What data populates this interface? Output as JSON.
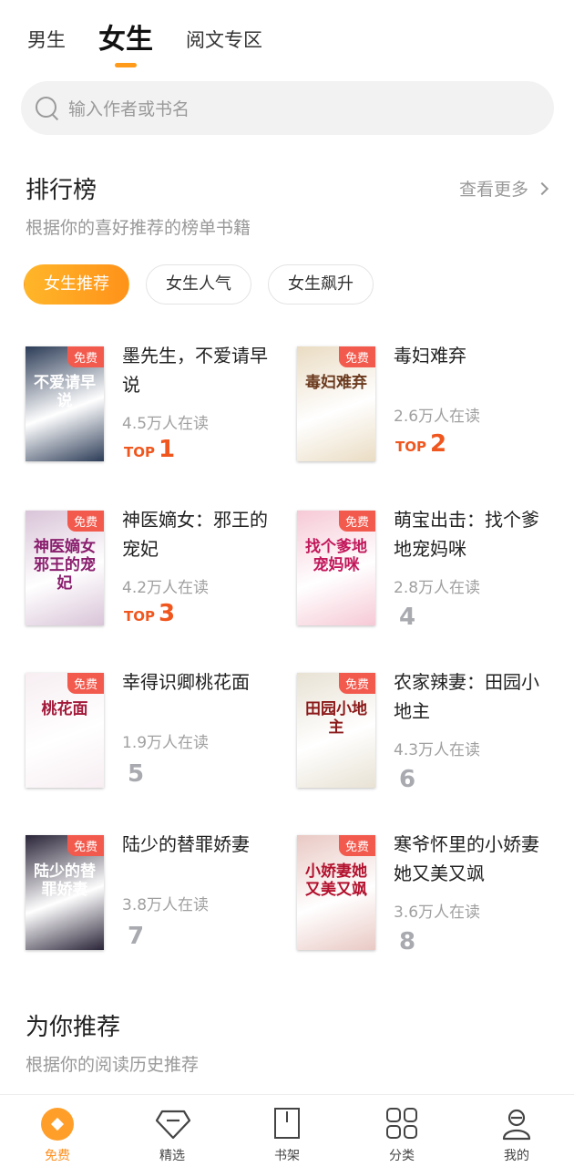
{
  "top_tabs": [
    {
      "label": "男生",
      "active": false
    },
    {
      "label": "女生",
      "active": true
    },
    {
      "label": "阅文专区",
      "active": false
    }
  ],
  "search": {
    "placeholder": "输入作者或书名"
  },
  "ranking": {
    "title": "排行榜",
    "subtitle": "根据你的喜好推荐的榜单书籍",
    "more_label": "查看更多",
    "chips": [
      {
        "label": "女生推荐",
        "active": true
      },
      {
        "label": "女生人气",
        "active": false
      },
      {
        "label": "女生飙升",
        "active": false
      }
    ],
    "books": [
      {
        "title": "墨先生，不爱请早说",
        "readers": "4.5万人在读",
        "rank": "1",
        "top": true,
        "badge": "免费",
        "cover_text": "不爱请早说",
        "cover_bg": "#2c3c57",
        "cover_fg": "#ffffff"
      },
      {
        "title": "毒妇难弃",
        "readers": "2.6万人在读",
        "rank": "2",
        "top": true,
        "badge": "免费",
        "cover_text": "毒妇难弃",
        "cover_bg": "#eadcc3",
        "cover_fg": "#6b3a1e"
      },
      {
        "title": "神医嫡女：邪王的宠妃",
        "readers": "4.2万人在读",
        "rank": "3",
        "top": true,
        "badge": "免费",
        "cover_text": "神医嫡女 邪王的宠妃",
        "cover_bg": "#d9c4d8",
        "cover_fg": "#8a1f6e"
      },
      {
        "title": "萌宝出击：找个爹地宠妈咪",
        "readers": "2.8万人在读",
        "rank": "4",
        "top": false,
        "badge": "免费",
        "cover_text": "找个爹地宠妈咪",
        "cover_bg": "#f6c9d6",
        "cover_fg": "#c2185b"
      },
      {
        "title": "幸得识卿桃花面",
        "readers": "1.9万人在读",
        "rank": "5",
        "top": false,
        "badge": "免费",
        "cover_text": "桃花面",
        "cover_bg": "#f7eef2",
        "cover_fg": "#a31a3a"
      },
      {
        "title": "农家辣妻：田园小地主",
        "readers": "4.3万人在读",
        "rank": "6",
        "top": false,
        "badge": "免费",
        "cover_text": "田园小地主",
        "cover_bg": "#e8e2d4",
        "cover_fg": "#8b1a1a"
      },
      {
        "title": "陆少的替罪娇妻",
        "readers": "3.8万人在读",
        "rank": "7",
        "top": false,
        "badge": "免费",
        "cover_text": "陆少的替罪娇妻",
        "cover_bg": "#2a2438",
        "cover_fg": "#ffffff"
      },
      {
        "title": "寒爷怀里的小娇妻她又美又飒",
        "readers": "3.6万人在读",
        "rank": "8",
        "top": false,
        "badge": "免费",
        "cover_text": "小娇妻她又美又飒",
        "cover_bg": "#e9c9c4",
        "cover_fg": "#b3122e"
      }
    ]
  },
  "recommend": {
    "title": "为你推荐",
    "subtitle": "根据你的阅读历史推荐"
  },
  "bottom_nav": [
    {
      "label": "免费",
      "icon": "free-icon",
      "active": true
    },
    {
      "label": "精选",
      "icon": "gem-icon",
      "active": false
    },
    {
      "label": "书架",
      "icon": "bookshelf-icon",
      "active": false
    },
    {
      "label": "分类",
      "icon": "category-grid-icon",
      "active": false
    },
    {
      "label": "我的",
      "icon": "profile-icon",
      "active": false
    }
  ],
  "colors": {
    "accent": "#ff9a1a",
    "top_rank": "#f0571f",
    "free_badge": "#f35a4e"
  },
  "rank_top_word": "TOP"
}
